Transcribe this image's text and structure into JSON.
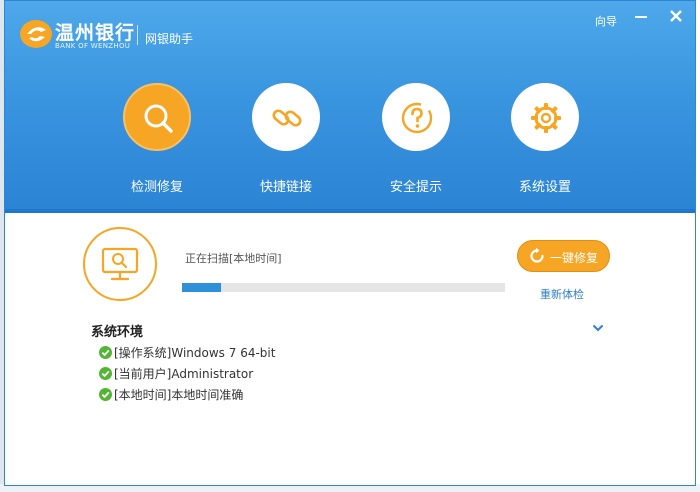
{
  "brand": {
    "name_cn": "温州银行",
    "name_en": "BANK OF WENZHOU",
    "subtitle": "网银助手"
  },
  "window_controls": {
    "guide_label": "向导"
  },
  "nav": {
    "items": [
      {
        "label": "检测修复",
        "icon": "search-icon",
        "active": true
      },
      {
        "label": "快捷链接",
        "icon": "link-icon",
        "active": false
      },
      {
        "label": "安全提示",
        "icon": "question-icon",
        "active": false
      },
      {
        "label": "系统设置",
        "icon": "gear-icon",
        "active": false
      }
    ]
  },
  "scan": {
    "status_text": "正在扫描[本地时间]",
    "progress_percent": 12,
    "fix_button_label": "一键修复",
    "recheck_label": "重新体检"
  },
  "environment": {
    "title": "系统环境",
    "items": [
      {
        "text": "[操作系统]Windows 7 64-bit",
        "status": "ok"
      },
      {
        "text": "[当前用户]Administrator",
        "status": "ok"
      },
      {
        "text": "[本地时间]本地时间准确",
        "status": "ok"
      }
    ]
  },
  "colors": {
    "header_blue": "#3a95e0",
    "accent_orange": "#f6a524",
    "progress_blue": "#2f8fd8",
    "ok_green": "#52b534",
    "link_blue": "#2f7fcf"
  }
}
